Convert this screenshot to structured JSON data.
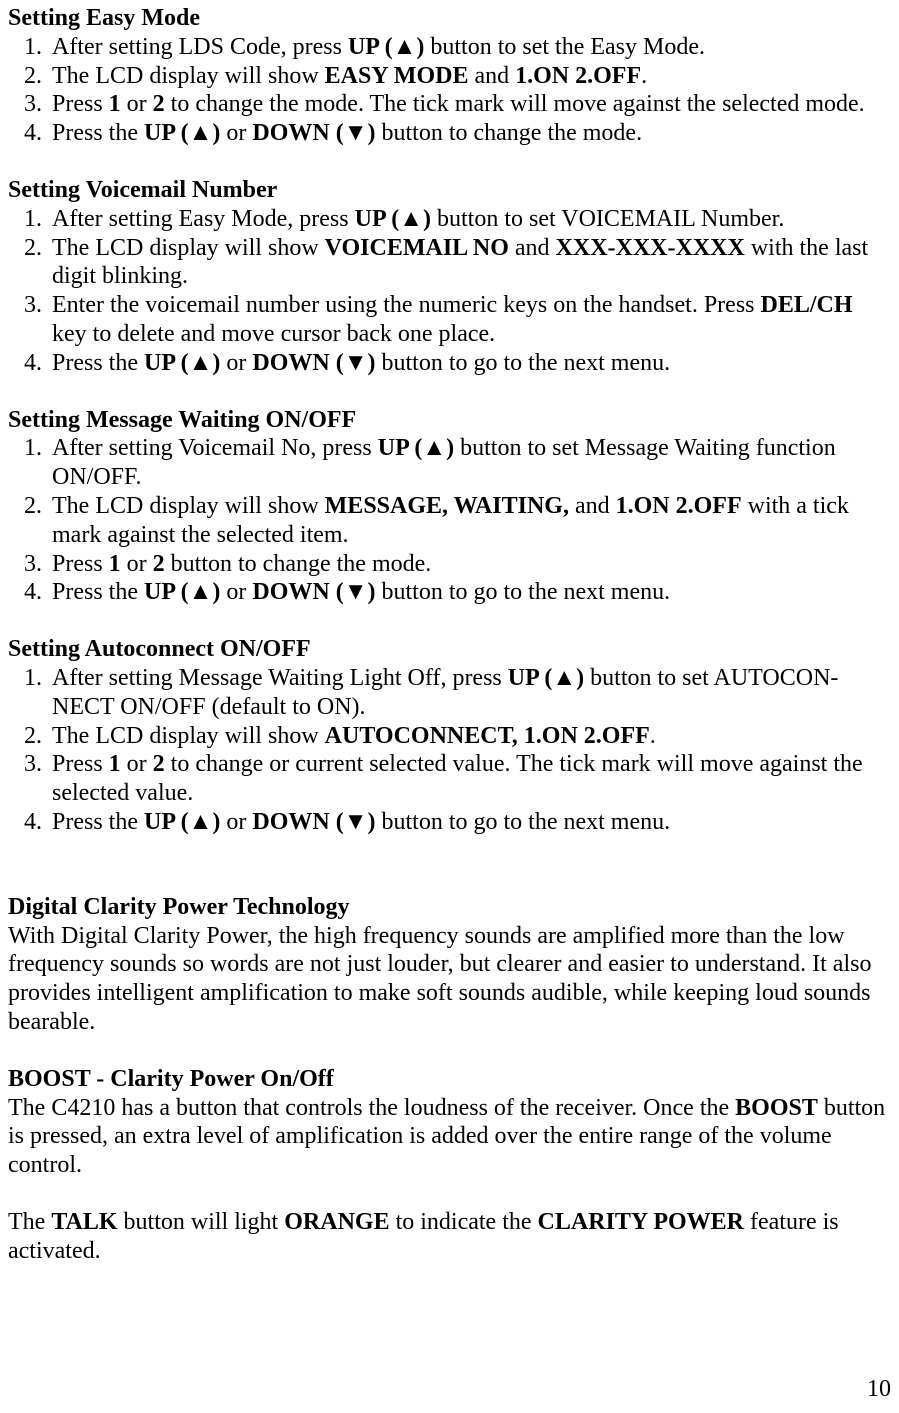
{
  "section1": {
    "heading": "Setting Easy Mode",
    "items": [
      {
        "pre": "After setting LDS Code, press ",
        "b1": "UP (▲)",
        "post": " button to set the Easy Mode."
      },
      {
        "pre": "The LCD display will show ",
        "b1": "EASY MODE",
        "mid1": " and ",
        "b2": "1.ON  2.OFF",
        "post": "."
      },
      {
        "pre": "Press ",
        "b1": "1",
        "mid1": " or ",
        "b2": "2",
        "post": " to change the mode. The tick mark will move against the selected mode."
      },
      {
        "pre": "Press the ",
        "b1": "UP (▲)",
        "mid1": " or ",
        "b2": "DOWN (▼)",
        "post": " button to change the mode."
      }
    ]
  },
  "section2": {
    "heading": "Setting Voicemail Number",
    "items": [
      {
        "pre": "After setting Easy Mode, press ",
        "b1": "UP (▲)",
        "post": " button to set VOICEMAIL Number."
      },
      {
        "pre": "The LCD display will show ",
        "b1": "VOICEMAIL NO",
        "mid1": " and ",
        "b2": "XXX-XXX-XXXX",
        "post": " with the last digit blinking."
      },
      {
        "pre": "Enter the voicemail number using the numeric keys on the handset. Press ",
        "b1": "DEL/CH",
        "post": " key to delete and move cursor back one place."
      },
      {
        "pre": "Press the ",
        "b1": "UP (▲)",
        "mid1": " or ",
        "b2": "DOWN (▼)",
        "post": " button to go to the next menu."
      }
    ]
  },
  "section3": {
    "heading": "Setting Message Waiting ON/OFF",
    "items": [
      {
        "pre": "After setting Voicemail No, press ",
        "b1": "UP (▲)",
        "post": " button to set Message Waiting function ON/OFF."
      },
      {
        "pre": "The LCD display will show ",
        "b1": "MESSAGE, WAITING,",
        "mid1": " and ",
        "b2": "1.ON  2.OFF",
        "post": " with a tick mark against the selected item."
      },
      {
        "pre": "Press ",
        "b1": "1",
        "mid1": " or ",
        "b2": "2",
        "post": " button to change the mode."
      },
      {
        "pre": "Press the ",
        "b1": "UP (▲)",
        "mid1": " or ",
        "b2": "DOWN (▼)",
        "post": " button to go to the next menu."
      }
    ]
  },
  "section4": {
    "heading": "Setting Autoconnect ON/OFF",
    "items": [
      {
        "pre": "After setting Message Waiting Light Off, press ",
        "b1": "UP (▲)",
        "post": " button to set AUTOCON-NECT ON/OFF (default to ON)."
      },
      {
        "pre": "The LCD display will show ",
        "b1": "AUTOCONNECT, 1.ON   2.OFF",
        "post": "."
      },
      {
        "pre": "Press ",
        "b1": "1",
        "mid1": " or ",
        "b2": "2",
        "post": " to change or current selected value. The tick mark will move against the selected value."
      },
      {
        "pre": "Press the ",
        "b1": "UP (▲)",
        "mid1": " or ",
        "b2": "DOWN (▼)",
        "post": " button to go to the next menu."
      }
    ]
  },
  "section5": {
    "heading": "Digital Clarity Power Technology",
    "para": "With Digital Clarity Power, the high frequency sounds are amplified more than the low frequency sounds so words are not just louder, but clearer and easier to understand.  It also provides intelligent amplification to make soft sounds audible, while keeping loud sounds bearable."
  },
  "section6": {
    "heading": "BOOST - Clarity Power On/Off",
    "para_pre": "The C4210 has a button that controls the loudness of the receiver. Once the ",
    "para_b1": "BOOST",
    "para_post": " button is pressed, an extra level of amplification is added over the entire range of the volume control.",
    "para2_pre": "The ",
    "para2_b1": "TALK",
    "para2_mid1": " button will light ",
    "para2_b2": "ORANGE",
    "para2_mid2": " to indicate the ",
    "para2_b3": "CLARITY POWER",
    "para2_post": " feature is activated."
  },
  "page_number": "10"
}
